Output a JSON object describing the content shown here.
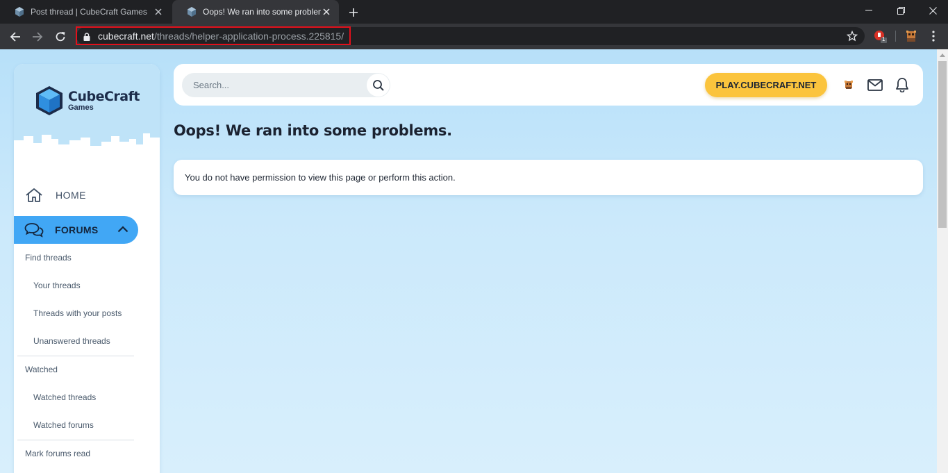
{
  "browser": {
    "tabs": [
      {
        "title": "Post thread | CubeCraft Games",
        "active": false
      },
      {
        "title": "Oops! We ran into some problems.",
        "active": true
      }
    ],
    "url_host": "cubecraft.net",
    "url_path": "/threads/helper-application-process.225815/",
    "extension_badge": "1"
  },
  "sidebar": {
    "logo_main": "CubeCraft",
    "logo_sub": "Games",
    "home_label": "HOME",
    "forums_label": "FORUMS",
    "items": [
      {
        "label": "Find threads"
      },
      {
        "label": "Your threads"
      },
      {
        "label": "Threads with your posts"
      },
      {
        "label": "Unanswered threads"
      },
      {
        "label": "Watched"
      },
      {
        "label": "Watched threads"
      },
      {
        "label": "Watched forums"
      },
      {
        "label": "Mark forums read"
      }
    ]
  },
  "topbar": {
    "search_placeholder": "Search...",
    "play_label": "PLAY.CUBECRAFT.NET"
  },
  "main": {
    "title": "Oops! We ran into some problems.",
    "message": "You do not have permission to view this page or perform this action."
  },
  "colors": {
    "accent_blue": "#41a7f5",
    "play_yellow": "#fbc43d",
    "url_highlight": "#e3101b"
  }
}
